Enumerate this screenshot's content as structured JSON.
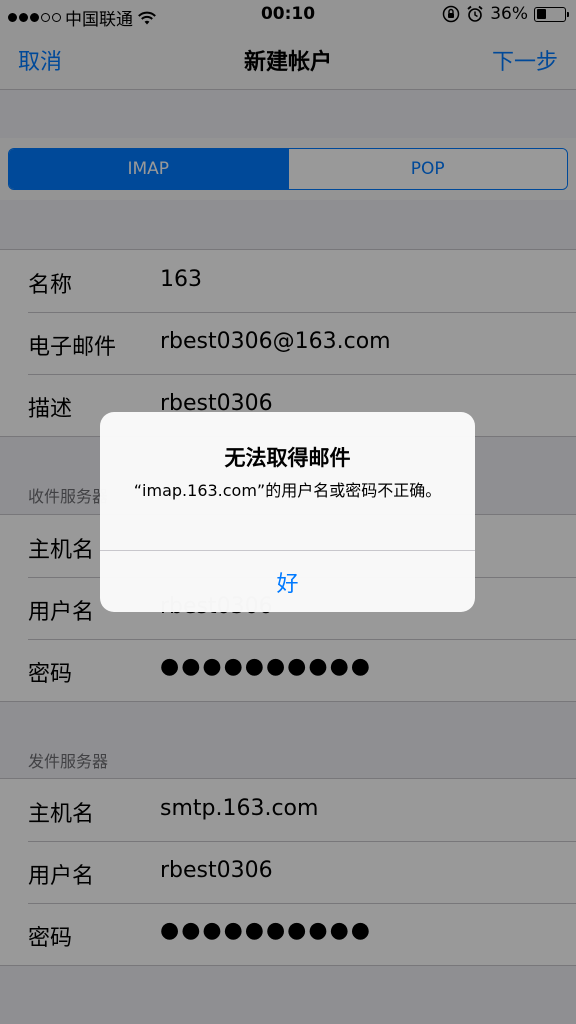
{
  "status_bar": {
    "carrier": "中国联通",
    "time": "00:10",
    "battery_percent": "36%",
    "battery_level": 0.36,
    "signal_bars_filled": 3,
    "signal_bars_total": 5
  },
  "nav": {
    "cancel_label": "取消",
    "title": "新建帐户",
    "next_label": "下一步"
  },
  "segments": {
    "selected": "IMAP",
    "items": [
      "IMAP",
      "POP"
    ]
  },
  "account": {
    "rows": [
      {
        "label": "名称",
        "value": "163"
      },
      {
        "label": "电子邮件",
        "value": "rbest0306@163.com"
      },
      {
        "label": "描述",
        "value": "rbest0306"
      }
    ]
  },
  "incoming": {
    "header": "收件服务器",
    "rows": [
      {
        "label": "主机名",
        "value": ""
      },
      {
        "label": "用户名",
        "value": "rbest0306"
      },
      {
        "label": "密码",
        "value": "●●●●●●●●●●"
      }
    ]
  },
  "outgoing": {
    "header": "发件服务器",
    "rows": [
      {
        "label": "主机名",
        "value": "smtp.163.com"
      },
      {
        "label": "用户名",
        "value": "rbest0306"
      },
      {
        "label": "密码",
        "value": "●●●●●●●●●●"
      }
    ]
  },
  "alert": {
    "title": "无法取得邮件",
    "message": "“imap.163.com”的用户名或密码不正确。",
    "ok_label": "好"
  },
  "colors": {
    "accent": "#007aff",
    "background": "#efeff4",
    "separator": "#c8c7cc"
  }
}
